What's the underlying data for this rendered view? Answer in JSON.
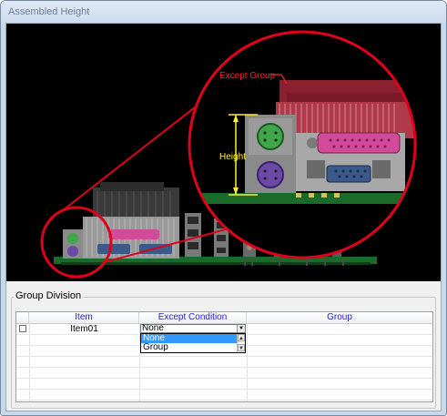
{
  "window": {
    "title": "Assembled Height"
  },
  "image": {
    "label_except_group": "Except Group",
    "label_height": "Height",
    "colors": {
      "magnifier": "#e0001a",
      "except_label": "#ff2020",
      "height_label": "#ffee33",
      "board": "#1a6b2a",
      "part_red": "#8a2030",
      "port_magenta": "#d24a9a",
      "port_blue": "#3a5a8a"
    }
  },
  "group_division": {
    "legend": "Group Division",
    "columns": [
      "",
      "Item",
      "Except Condition",
      "Group"
    ],
    "rows": [
      {
        "checked": false,
        "item": "Item01",
        "except_condition": "None",
        "group": ""
      }
    ],
    "dropdown": {
      "options": [
        "None",
        "Group"
      ],
      "selected": "None"
    }
  }
}
